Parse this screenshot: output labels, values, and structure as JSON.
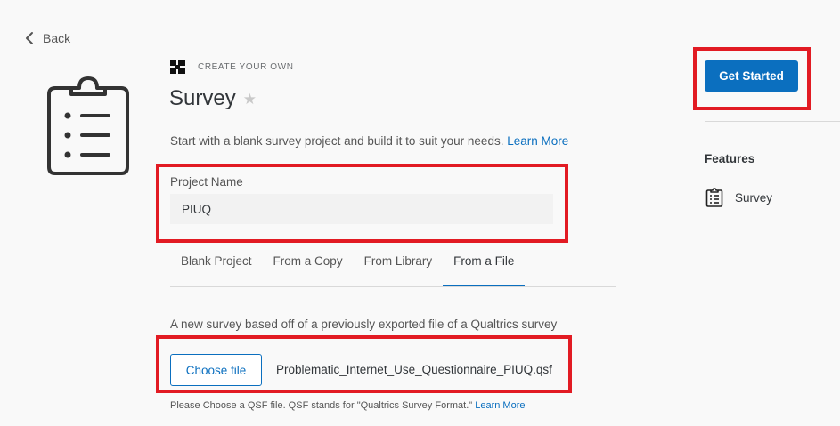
{
  "nav": {
    "back_label": "Back"
  },
  "header": {
    "kicker": "CREATE YOUR OWN",
    "title": "Survey"
  },
  "description": {
    "text": "Start with a blank survey project and build it to suit your needs. ",
    "link": "Learn More"
  },
  "project": {
    "label": "Project Name",
    "value": "PIUQ"
  },
  "tabs": [
    {
      "label": "Blank Project",
      "active": false
    },
    {
      "label": "From a Copy",
      "active": false
    },
    {
      "label": "From Library",
      "active": false
    },
    {
      "label": "From a File",
      "active": true
    }
  ],
  "file_panel": {
    "description": "A new survey based off of a previously exported file of a Qualtrics survey",
    "choose_label": "Choose file",
    "file_name": "Problematic_Internet_Use_Questionnaire_PIUQ.qsf",
    "hint": "Please Choose a QSF file. QSF stands for \"Qualtrics Survey Format.\" ",
    "hint_link": "Learn More"
  },
  "sidebar": {
    "get_started_label": "Get Started",
    "features_heading": "Features",
    "features": [
      {
        "label": "Survey",
        "icon": "clipboard-icon"
      }
    ]
  },
  "colors": {
    "accent": "#0b6fbf",
    "highlight": "#e21b23"
  }
}
